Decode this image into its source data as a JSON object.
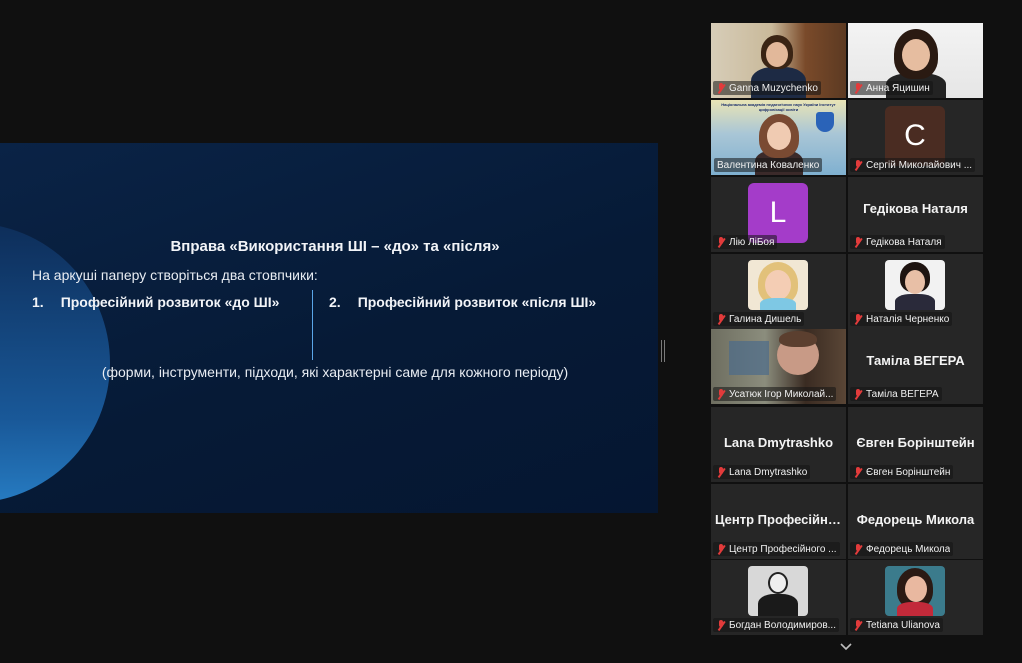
{
  "slide": {
    "title": "Вправа «Використання ШІ – «до» та «після»",
    "intro": "На аркуші паперу створіться два стовпчики:",
    "columns": [
      {
        "num": "1.",
        "label": "Професійний розвиток «до ШІ»"
      },
      {
        "num": "2.",
        "label": "Професійний розвиток «після ШІ»"
      }
    ],
    "footnote": "(форми, інструменти, підходи, які характерні саме для кожного періоду)"
  },
  "participants": [
    {
      "name": "Ganna Muzychenko",
      "kind": "video"
    },
    {
      "name": "Анна Яцишин",
      "kind": "video"
    },
    {
      "name": "Валентина Коваленко",
      "kind": "video",
      "active": true,
      "banner": "Національна академія педагогічних наук України Інститут цифровізації освіти"
    },
    {
      "name": "Сергій Миколайович ...",
      "kind": "avatar",
      "letter": "C",
      "color": "#4a2c22"
    },
    {
      "name": "Лію ЛіБоя",
      "kind": "avatar",
      "letter": "L",
      "color": "#a43cc9"
    },
    {
      "name": "Гедікова Наталя",
      "kind": "text",
      "display": "Гедікова Наталя"
    },
    {
      "name": "Галина Дишель",
      "kind": "photo"
    },
    {
      "name": "Наталія Черненко",
      "kind": "photo"
    },
    {
      "name": "Усатюк Ігор Миколай...",
      "kind": "video"
    },
    {
      "name": "Таміла ВЕГЕРА",
      "kind": "text",
      "display": "Таміла ВЕГЕРА"
    },
    {
      "name": "Lana Dmytrashko",
      "kind": "text",
      "display": "Lana Dmytrashko"
    },
    {
      "name": "Євген Борінштейн",
      "kind": "text",
      "display": "Євген Борінштейн"
    },
    {
      "name": "Центр Професійного ...",
      "kind": "text",
      "display": "Центр Професійного"
    },
    {
      "name": "Федорець Микола",
      "kind": "text",
      "display": "Федорець Микола"
    },
    {
      "name": "Богдан Володимиров...",
      "kind": "photo"
    },
    {
      "name": "Tetiana Ulianova",
      "kind": "photo"
    }
  ],
  "colors": {
    "active_speaker": "#22d36a",
    "muted_mic": "#e23b3b",
    "slide_bg": "#061a36"
  },
  "icons": {
    "muted": "mic-muted-icon",
    "more": "chevron-down-icon"
  }
}
